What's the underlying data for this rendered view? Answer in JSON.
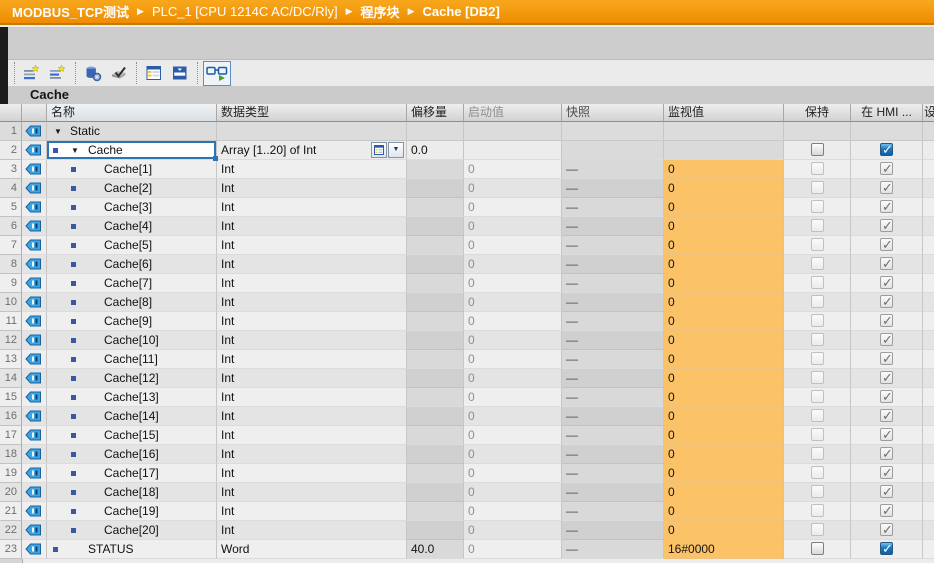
{
  "colors": {
    "breadcrumb_bg": "#f29204",
    "monitor_value_bg": "#fbc268",
    "checkbox_checked_blue": "#1d76bd",
    "selection_blue": "#2e74b5"
  },
  "breadcrumb": {
    "separator": "▶",
    "items": [
      {
        "label": "MODBUS_TCP测试",
        "bold": true
      },
      {
        "label": "PLC_1 [CPU 1214C AC/DC/Rly]",
        "bold": false
      },
      {
        "label": "程序块",
        "bold": true
      },
      {
        "label": "Cache [DB2]",
        "bold": true
      }
    ]
  },
  "toolbar": {
    "buttons": [
      {
        "icon": "insert-row-icon"
      },
      {
        "icon": "add-row-icon"
      },
      {
        "icon": "keep-actual-values-icon"
      },
      {
        "icon": "snapshot-values-icon"
      },
      {
        "icon": "copy-snapshot-to-start-icon"
      },
      {
        "icon": "load-start-values-icon"
      },
      {
        "icon": "monitor-all-glasses-icon"
      }
    ]
  },
  "title": "Cache",
  "table": {
    "headers": {
      "name": "名称",
      "datatype": "数据类型",
      "offset": "偏移量",
      "start": "启动值",
      "snapshot": "快照",
      "monitor": "监视值",
      "retain": "保持",
      "hmi": "在 HMI ...",
      "clipped": "设"
    },
    "rows": [
      {
        "n": "1",
        "lv": 1,
        "ex": true,
        "bu": false,
        "name": "Static",
        "ty": "",
        "off": "",
        "st": "",
        "sn": "",
        "mo": "",
        "mos": "",
        "ret": "none",
        "hmi": "none",
        "sh": "r1",
        "sel": false,
        "tb": false
      },
      {
        "n": "2",
        "lv": 2,
        "ex": true,
        "bu": true,
        "name": "Cache",
        "ty": "Array [1..20] of Int",
        "off": "0.0",
        "st": "",
        "sn": "",
        "mo": "",
        "mos": "gray",
        "ret": "en-un",
        "hmi": "en-ck",
        "sh": "r2",
        "sel": true,
        "tb": true
      },
      {
        "n": "3",
        "lv": 3,
        "ex": false,
        "bu": true,
        "name": "Cache[1]",
        "ty": "Int",
        "off": "",
        "st": "0",
        "sn": "—",
        "mo": "0",
        "mos": "orange",
        "ret": "dis-un",
        "hmi": "dis-ck",
        "sh": "odd",
        "sel": false,
        "tb": false
      },
      {
        "n": "4",
        "lv": 3,
        "ex": false,
        "bu": true,
        "name": "Cache[2]",
        "ty": "Int",
        "off": "",
        "st": "0",
        "sn": "—",
        "mo": "0",
        "mos": "orange",
        "ret": "dis-un",
        "hmi": "dis-ck",
        "sh": "even",
        "sel": false,
        "tb": false
      },
      {
        "n": "5",
        "lv": 3,
        "ex": false,
        "bu": true,
        "name": "Cache[3]",
        "ty": "Int",
        "off": "",
        "st": "0",
        "sn": "—",
        "mo": "0",
        "mos": "orange",
        "ret": "dis-un",
        "hmi": "dis-ck",
        "sh": "odd",
        "sel": false,
        "tb": false
      },
      {
        "n": "6",
        "lv": 3,
        "ex": false,
        "bu": true,
        "name": "Cache[4]",
        "ty": "Int",
        "off": "",
        "st": "0",
        "sn": "—",
        "mo": "0",
        "mos": "orange",
        "ret": "dis-un",
        "hmi": "dis-ck",
        "sh": "even",
        "sel": false,
        "tb": false
      },
      {
        "n": "7",
        "lv": 3,
        "ex": false,
        "bu": true,
        "name": "Cache[5]",
        "ty": "Int",
        "off": "",
        "st": "0",
        "sn": "—",
        "mo": "0",
        "mos": "orange",
        "ret": "dis-un",
        "hmi": "dis-ck",
        "sh": "odd",
        "sel": false,
        "tb": false
      },
      {
        "n": "8",
        "lv": 3,
        "ex": false,
        "bu": true,
        "name": "Cache[6]",
        "ty": "Int",
        "off": "",
        "st": "0",
        "sn": "—",
        "mo": "0",
        "mos": "orange",
        "ret": "dis-un",
        "hmi": "dis-ck",
        "sh": "even",
        "sel": false,
        "tb": false
      },
      {
        "n": "9",
        "lv": 3,
        "ex": false,
        "bu": true,
        "name": "Cache[7]",
        "ty": "Int",
        "off": "",
        "st": "0",
        "sn": "—",
        "mo": "0",
        "mos": "orange",
        "ret": "dis-un",
        "hmi": "dis-ck",
        "sh": "odd",
        "sel": false,
        "tb": false
      },
      {
        "n": "10",
        "lv": 3,
        "ex": false,
        "bu": true,
        "name": "Cache[8]",
        "ty": "Int",
        "off": "",
        "st": "0",
        "sn": "—",
        "mo": "0",
        "mos": "orange",
        "ret": "dis-un",
        "hmi": "dis-ck",
        "sh": "even",
        "sel": false,
        "tb": false
      },
      {
        "n": "11",
        "lv": 3,
        "ex": false,
        "bu": true,
        "name": "Cache[9]",
        "ty": "Int",
        "off": "",
        "st": "0",
        "sn": "—",
        "mo": "0",
        "mos": "orange",
        "ret": "dis-un",
        "hmi": "dis-ck",
        "sh": "odd",
        "sel": false,
        "tb": false
      },
      {
        "n": "12",
        "lv": 3,
        "ex": false,
        "bu": true,
        "name": "Cache[10]",
        "ty": "Int",
        "off": "",
        "st": "0",
        "sn": "—",
        "mo": "0",
        "mos": "orange",
        "ret": "dis-un",
        "hmi": "dis-ck",
        "sh": "even",
        "sel": false,
        "tb": false
      },
      {
        "n": "13",
        "lv": 3,
        "ex": false,
        "bu": true,
        "name": "Cache[11]",
        "ty": "Int",
        "off": "",
        "st": "0",
        "sn": "—",
        "mo": "0",
        "mos": "orange",
        "ret": "dis-un",
        "hmi": "dis-ck",
        "sh": "odd",
        "sel": false,
        "tb": false
      },
      {
        "n": "14",
        "lv": 3,
        "ex": false,
        "bu": true,
        "name": "Cache[12]",
        "ty": "Int",
        "off": "",
        "st": "0",
        "sn": "—",
        "mo": "0",
        "mos": "orange",
        "ret": "dis-un",
        "hmi": "dis-ck",
        "sh": "even",
        "sel": false,
        "tb": false
      },
      {
        "n": "15",
        "lv": 3,
        "ex": false,
        "bu": true,
        "name": "Cache[13]",
        "ty": "Int",
        "off": "",
        "st": "0",
        "sn": "—",
        "mo": "0",
        "mos": "orange",
        "ret": "dis-un",
        "hmi": "dis-ck",
        "sh": "odd",
        "sel": false,
        "tb": false
      },
      {
        "n": "16",
        "lv": 3,
        "ex": false,
        "bu": true,
        "name": "Cache[14]",
        "ty": "Int",
        "off": "",
        "st": "0",
        "sn": "—",
        "mo": "0",
        "mos": "orange",
        "ret": "dis-un",
        "hmi": "dis-ck",
        "sh": "even",
        "sel": false,
        "tb": false
      },
      {
        "n": "17",
        "lv": 3,
        "ex": false,
        "bu": true,
        "name": "Cache[15]",
        "ty": "Int",
        "off": "",
        "st": "0",
        "sn": "—",
        "mo": "0",
        "mos": "orange",
        "ret": "dis-un",
        "hmi": "dis-ck",
        "sh": "odd",
        "sel": false,
        "tb": false
      },
      {
        "n": "18",
        "lv": 3,
        "ex": false,
        "bu": true,
        "name": "Cache[16]",
        "ty": "Int",
        "off": "",
        "st": "0",
        "sn": "—",
        "mo": "0",
        "mos": "orange",
        "ret": "dis-un",
        "hmi": "dis-ck",
        "sh": "even",
        "sel": false,
        "tb": false
      },
      {
        "n": "19",
        "lv": 3,
        "ex": false,
        "bu": true,
        "name": "Cache[17]",
        "ty": "Int",
        "off": "",
        "st": "0",
        "sn": "—",
        "mo": "0",
        "mos": "orange",
        "ret": "dis-un",
        "hmi": "dis-ck",
        "sh": "odd",
        "sel": false,
        "tb": false
      },
      {
        "n": "20",
        "lv": 3,
        "ex": false,
        "bu": true,
        "name": "Cache[18]",
        "ty": "Int",
        "off": "",
        "st": "0",
        "sn": "—",
        "mo": "0",
        "mos": "orange",
        "ret": "dis-un",
        "hmi": "dis-ck",
        "sh": "even",
        "sel": false,
        "tb": false
      },
      {
        "n": "21",
        "lv": 3,
        "ex": false,
        "bu": true,
        "name": "Cache[19]",
        "ty": "Int",
        "off": "",
        "st": "0",
        "sn": "—",
        "mo": "0",
        "mos": "orange",
        "ret": "dis-un",
        "hmi": "dis-ck",
        "sh": "odd",
        "sel": false,
        "tb": false
      },
      {
        "n": "22",
        "lv": 3,
        "ex": false,
        "bu": true,
        "name": "Cache[20]",
        "ty": "Int",
        "off": "",
        "st": "0",
        "sn": "—",
        "mo": "0",
        "mos": "orange",
        "ret": "dis-un",
        "hmi": "dis-ck",
        "sh": "even",
        "sel": false,
        "tb": false
      },
      {
        "n": "23",
        "lv": 2,
        "ex": false,
        "bu": true,
        "name": "STATUS",
        "ty": "Word",
        "off": "40.0",
        "st": "0",
        "sn": "—",
        "mo": "16#0000",
        "mos": "orange",
        "ret": "en-un",
        "hmi": "en-ck",
        "sh": "odd",
        "sel": false,
        "tb": false
      }
    ]
  }
}
